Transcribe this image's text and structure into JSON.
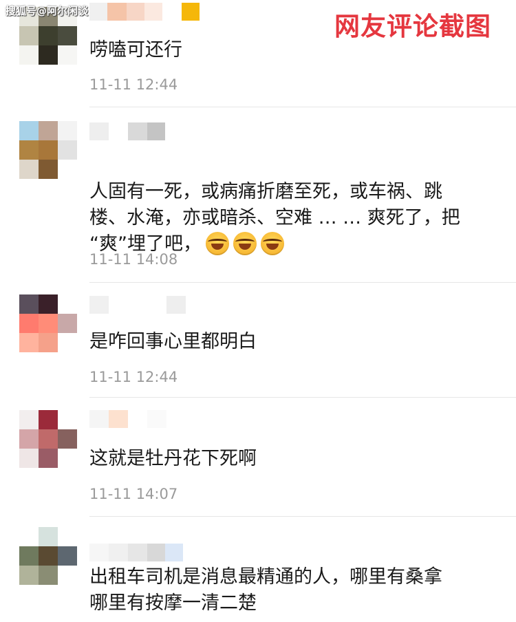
{
  "watermark": "搜狐号@阿尔闲谈",
  "stamp": "网友评论截图",
  "comments": [
    {
      "text": "唠嗑可还行",
      "time": "11-11 12:44"
    },
    {
      "text": "人固有一死，或病痛折磨至死，或车祸、跳\n楼、水淹，亦或暗杀、空难 … … 爽死了，把\n“爽”埋了吧，",
      "time": "11-11 14:08",
      "emoji": "laugh-cry-emoji"
    },
    {
      "text": "是咋回事心里都明白",
      "time": "11-11 12:44"
    },
    {
      "text": "这就是牡丹花下死啊",
      "time": "11-11 14:07"
    },
    {
      "text": "出租车司机是消息最精通的人，哪里有桑拿\n哪里有按摩一清二楚",
      "time": ""
    }
  ]
}
